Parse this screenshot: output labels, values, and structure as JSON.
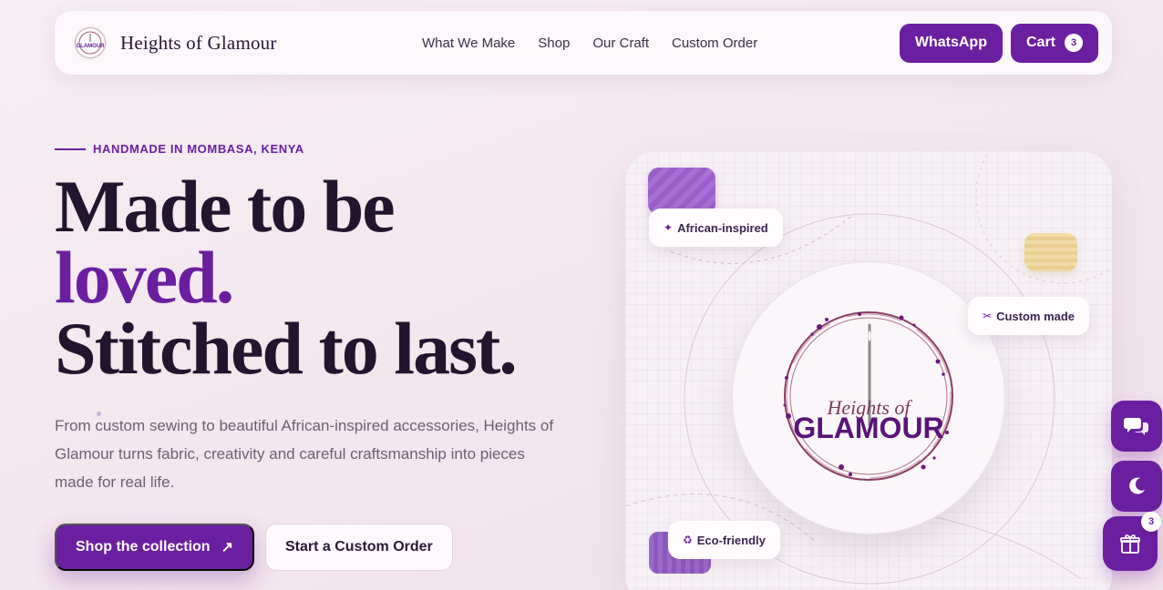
{
  "header": {
    "brand": "Heights of Glamour",
    "nav": [
      "What We Make",
      "Shop",
      "Our Craft",
      "Custom Order"
    ],
    "whatsapp_label": "WhatsApp",
    "cart_label": "Cart",
    "cart_count": "3"
  },
  "hero": {
    "eyebrow": "HANDMADE IN MOMBASA, KENYA",
    "headline_line1": "Made to be",
    "headline_accent": "loved.",
    "headline_line3": "Stitched to last.",
    "intro": "From custom sewing to beautiful African-inspired accessories, Heights of Glamour turns fabric, creativity and careful craftsmanship into pieces made for real life.",
    "primary_cta": "Shop the collection",
    "primary_cta_arrow": "↗",
    "secondary_cta": "Start a Custom Order"
  },
  "visual": {
    "badges": [
      {
        "icon": "✦",
        "label": "African-inspired"
      },
      {
        "icon": "✂",
        "label": "Custom made"
      },
      {
        "icon": "♻",
        "label": "Eco-friendly"
      }
    ],
    "logo_script": "Heights of",
    "logo_word": "GLAMOUR"
  },
  "floating": {
    "gift_count": "3"
  },
  "colors": {
    "brand_purple": "#6a1fa0",
    "ink": "#23142f",
    "background": "#f3e6ee"
  },
  "icons": [
    "chat-icon",
    "moon-icon",
    "gift-icon",
    "needle-icon"
  ]
}
